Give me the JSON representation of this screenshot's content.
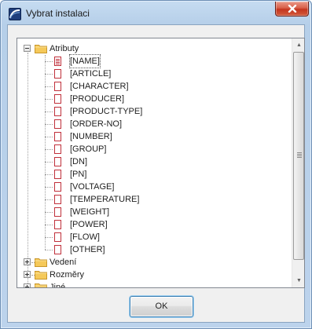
{
  "window": {
    "title": "Vybrat instalaci",
    "title_icon": "app-window-icon",
    "close_icon": "close-x-icon"
  },
  "tree": {
    "root": {
      "label": "Atributy",
      "icon": "folder-icon",
      "expanded": true,
      "children": [
        {
          "label": "[NAME]",
          "selected": true
        },
        {
          "label": "[ARTICLE]"
        },
        {
          "label": "[CHARACTER]"
        },
        {
          "label": "[PRODUCER]"
        },
        {
          "label": "[PRODUCT-TYPE]"
        },
        {
          "label": "[ORDER-NO]"
        },
        {
          "label": "[NUMBER]"
        },
        {
          "label": "[GROUP]"
        },
        {
          "label": "[DN]"
        },
        {
          "label": "[PN]"
        },
        {
          "label": "[VOLTAGE]"
        },
        {
          "label": "[TEMPERATURE]"
        },
        {
          "label": "[WEIGHT]"
        },
        {
          "label": "[POWER]"
        },
        {
          "label": "[FLOW]"
        },
        {
          "label": "[OTHER]"
        }
      ]
    },
    "collapsed_nodes": [
      {
        "label": "Vedení",
        "icon": "folder-icon"
      },
      {
        "label": "Rozměry",
        "icon": "folder-icon"
      },
      {
        "label": "Jiné",
        "icon": "folder-icon"
      }
    ]
  },
  "buttons": {
    "ok_label": "OK"
  },
  "colors": {
    "item_icon": "#c0303b",
    "folder": "#f2c14e",
    "focus_border": "#3c7fb1"
  }
}
